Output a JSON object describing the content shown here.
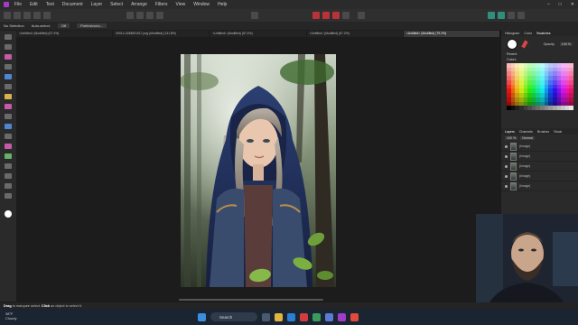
{
  "menu": {
    "items": [
      "File",
      "Edit",
      "Text",
      "Document",
      "Layer",
      "Select",
      "Arrange",
      "Filters",
      "View",
      "Window",
      "Help"
    ]
  },
  "context_bar": {
    "selection": "No Selection",
    "auto_select_label": "Auto-select:",
    "auto_select_value": "Off",
    "preferences_label": "Preferences..."
  },
  "doc_tabs": [
    {
      "label": "<Untitled> (Modified) (67.4%)",
      "active": false
    },
    {
      "label": "00012-4248691017.png (Modified) (131.8%)",
      "active": false
    },
    {
      "label": "<Untitled> (Modified) (67.4%)",
      "active": false
    },
    {
      "label": "<Untitled> (Modified) (67.2%)",
      "active": false
    },
    {
      "label": "<Untitled> (Modified) (79.2%)",
      "active": true
    }
  ],
  "right_panel": {
    "top_tabs": [
      "Histogram",
      "Color",
      "Swatches"
    ],
    "opacity_label": "Opacity",
    "opacity_value": "100 %",
    "fill_label": "Recent",
    "palette_label": "Colors",
    "layers_tabs": [
      "Layers",
      "Channels",
      "Brushes",
      "Stock"
    ],
    "blend_opacity": "100 %",
    "blend_mode": "Normal",
    "layers": [
      {
        "name": "(Image)"
      },
      {
        "name": "(Image)"
      },
      {
        "name": "(Image)"
      },
      {
        "name": "(Image)"
      },
      {
        "name": "(Image)"
      }
    ],
    "navigator_tabs": [
      "Navigator",
      "Transform",
      "History"
    ],
    "zoom_value": "67 %"
  },
  "status_bar": {
    "drag_word": "Drag",
    "drag_text": " to marquee select. ",
    "click_word": "Click",
    "click_text": " an object to select it."
  },
  "taskbar": {
    "temperature": "38°F",
    "weather": "Cloudy",
    "search_label": "Search"
  },
  "colors": {
    "app_accent": "#a03cc8",
    "record_red": "#b8323a",
    "teal": "#2e8f7b"
  }
}
